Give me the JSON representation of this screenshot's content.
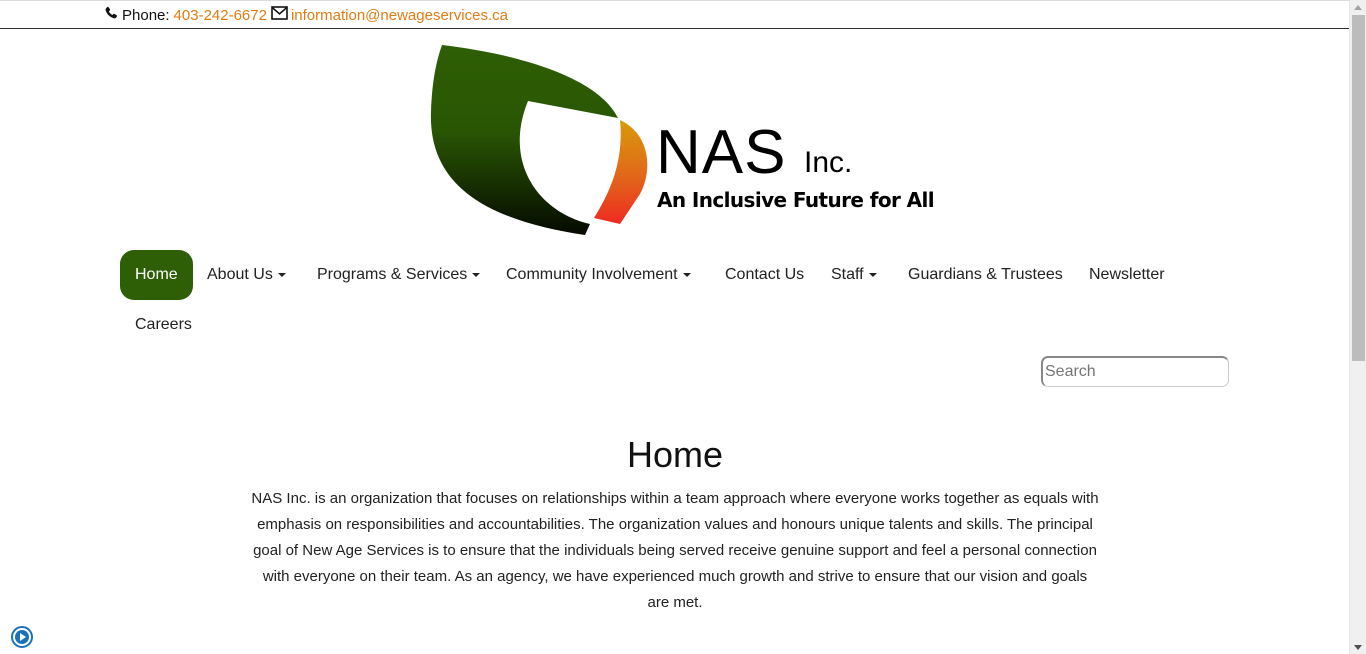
{
  "topbar": {
    "phone_label": "Phone:",
    "phone_number": "403-242-6672",
    "email": "information@newageservices.ca",
    "link_color": "#e07c12"
  },
  "logo": {
    "name": "NAS",
    "suffix": "Inc.",
    "tagline": "An Inclusive Future for All",
    "colors": {
      "leaf_top": "#2e5e05",
      "leaf_bottom": "#050a00",
      "accent_top": "#d99a0a",
      "accent_bottom": "#ee2a22"
    }
  },
  "nav": {
    "active_color": "#2e5e05",
    "items": [
      {
        "label": "Home",
        "active": true,
        "dropdown": false
      },
      {
        "label": "About Us",
        "active": false,
        "dropdown": true
      },
      {
        "label": "Programs & Services",
        "active": false,
        "dropdown": true
      },
      {
        "label": "Community Involvement",
        "active": false,
        "dropdown": true
      },
      {
        "label": "Contact Us",
        "active": false,
        "dropdown": false
      },
      {
        "label": "Staff",
        "active": false,
        "dropdown": true
      },
      {
        "label": "Guardians & Trustees",
        "active": false,
        "dropdown": false
      },
      {
        "label": "Newsletter",
        "active": false,
        "dropdown": false
      },
      {
        "label": "Careers",
        "active": false,
        "dropdown": false
      }
    ]
  },
  "search": {
    "placeholder": "Search",
    "value": ""
  },
  "main": {
    "title": "Home",
    "body": "NAS Inc. is an organization that focuses on relationships within a team approach where everyone works together as equals with emphasis on responsibilities and accountabilities. The organization values and honours unique talents and skills. The principal goal of New Age Services is to ensure that the individuals being served receive genuine support and feel a personal connection with everyone on their team. As an agency, we have experienced much growth and strive to ensure that our vision and goals are met."
  },
  "widgets": {
    "play_button_icon": "play-circle-icon"
  }
}
